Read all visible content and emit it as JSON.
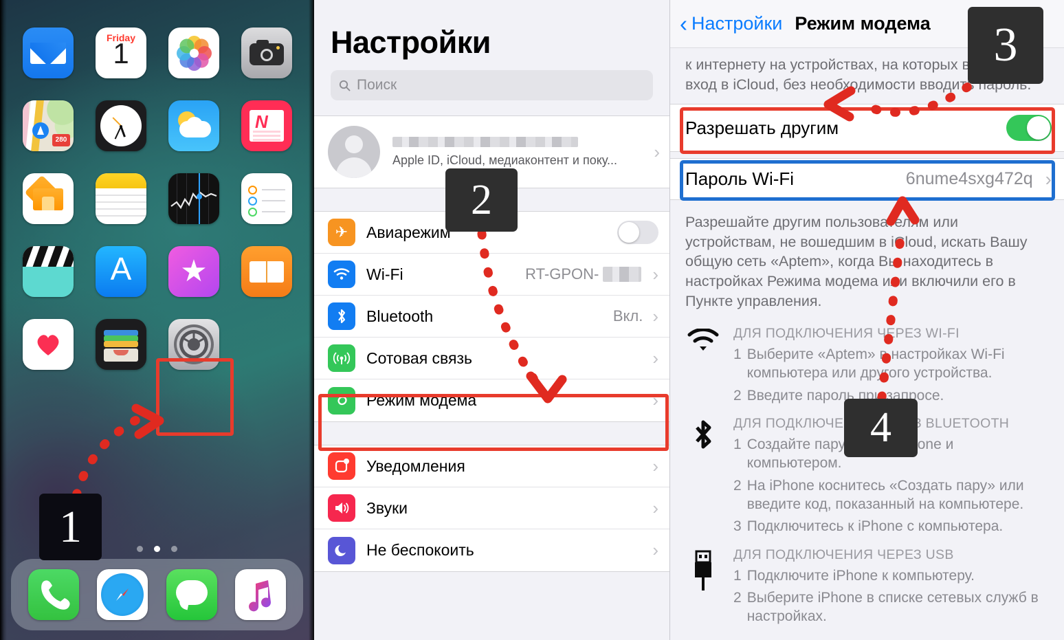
{
  "steps": {
    "one": "1",
    "two": "2",
    "three": "3",
    "four": "4"
  },
  "home_screen": {
    "calendar": {
      "weekday": "Friday",
      "day": "1"
    },
    "maps_shield": "280",
    "apps": [
      {
        "name": "Mail"
      },
      {
        "name": "Calendar"
      },
      {
        "name": "Photos"
      },
      {
        "name": "Camera"
      },
      {
        "name": "Maps"
      },
      {
        "name": "Clock"
      },
      {
        "name": "Weather"
      },
      {
        "name": "News"
      },
      {
        "name": "Home"
      },
      {
        "name": "Notes"
      },
      {
        "name": "Stocks"
      },
      {
        "name": "Reminders"
      },
      {
        "name": "TV"
      },
      {
        "name": "App Store"
      },
      {
        "name": "iTunes Store"
      },
      {
        "name": "Books"
      },
      {
        "name": "Health"
      },
      {
        "name": "Wallet"
      },
      {
        "name": "Settings"
      }
    ],
    "dock": [
      {
        "name": "Phone"
      },
      {
        "name": "Safari"
      },
      {
        "name": "Messages"
      },
      {
        "name": "Music"
      }
    ],
    "page_dots": 3,
    "active_dot": 2
  },
  "settings": {
    "title": "Настройки",
    "search_placeholder": "Поиск",
    "account": {
      "name_redacted": "",
      "subtitle": "Apple ID, iCloud, медиаконтент и поку..."
    },
    "rows": [
      {
        "label": "Авиарежим",
        "value": "",
        "type": "toggle",
        "on": false,
        "icon": "airplane-icon",
        "color": "#f79421"
      },
      {
        "label": "Wi-Fi",
        "value": "RT-GPON-",
        "type": "chevron",
        "icon": "wifi-icon",
        "color": "#127df2",
        "redacted": true
      },
      {
        "label": "Bluetooth",
        "value": "Вкл.",
        "type": "chevron",
        "icon": "bluetooth-icon",
        "color": "#127df2"
      },
      {
        "label": "Сотовая связь",
        "value": "",
        "type": "chevron",
        "icon": "cellular-icon",
        "color": "#34c759"
      },
      {
        "label": "Режим модема",
        "value": "",
        "type": "chevron",
        "icon": "hotspot-icon",
        "color": "#34c759",
        "highlighted": true
      }
    ],
    "rows2": [
      {
        "label": "Уведомления",
        "value": "",
        "type": "chevron",
        "icon": "notifications-icon",
        "color": "#ff3b30"
      },
      {
        "label": "Звуки",
        "value": "",
        "type": "chevron",
        "icon": "sounds-icon",
        "color": "#f6274e"
      },
      {
        "label": "Не беспокоить",
        "value": "",
        "type": "chevron",
        "icon": "moon-icon",
        "color": "#5856d6"
      }
    ]
  },
  "hotspot": {
    "back_label": "Настройки",
    "title": "Режим модема",
    "top_text": "к интернету на устройствах, на которых выполнен вход в iCloud, без необходимости вводить пароль.",
    "allow_label": "Разрешать другим",
    "allow_on": true,
    "password_label": "Пароль Wi-Fi",
    "password_value": "6nume4sxg472q",
    "description": "Разрешайте другим пользователям или устройствам, не вошедшим в iCloud, искать Вашу общую сеть «Aptem», когда Вы находитесь в настройках Режима модема или включили его в Пункте управления.",
    "sections": [
      {
        "icon": "wifi-icon",
        "header": "ДЛЯ ПОДКЛЮЧЕНИЯ ЧЕРЕЗ WI-FI",
        "items": [
          {
            "num": "1",
            "text": "Выберите «Aptem» в настройках Wi-Fi компьютера или другого устройства."
          },
          {
            "num": "2",
            "text": "Введите пароль при запросе."
          }
        ]
      },
      {
        "icon": "bluetooth-icon",
        "header": "ДЛЯ ПОДКЛЮЧЕНИЯ ЧЕРЕЗ BLUETOOTH",
        "items": [
          {
            "num": "1",
            "text": "Создайте пару между iPhone и компьютером."
          },
          {
            "num": "2",
            "text": "На iPhone коснитесь «Создать пару» или введите код, показанный на компьютере."
          },
          {
            "num": "3",
            "text": "Подключитесь к iPhone с компьютера."
          }
        ]
      },
      {
        "icon": "usb-icon",
        "header": "ДЛЯ ПОДКЛЮЧЕНИЯ ЧЕРЕЗ USB",
        "items": [
          {
            "num": "1",
            "text": "Подключите iPhone к компьютеру."
          },
          {
            "num": "2",
            "text": "Выберите iPhone в списке сетевых служб в настройках."
          }
        ]
      }
    ]
  },
  "colors": {
    "highlight_red": "#e83b2c",
    "highlight_blue": "#1f6fd0",
    "toggle_on": "#34c759",
    "ios_blue": "#0a7cff",
    "arrow_red": "#e02a20"
  }
}
